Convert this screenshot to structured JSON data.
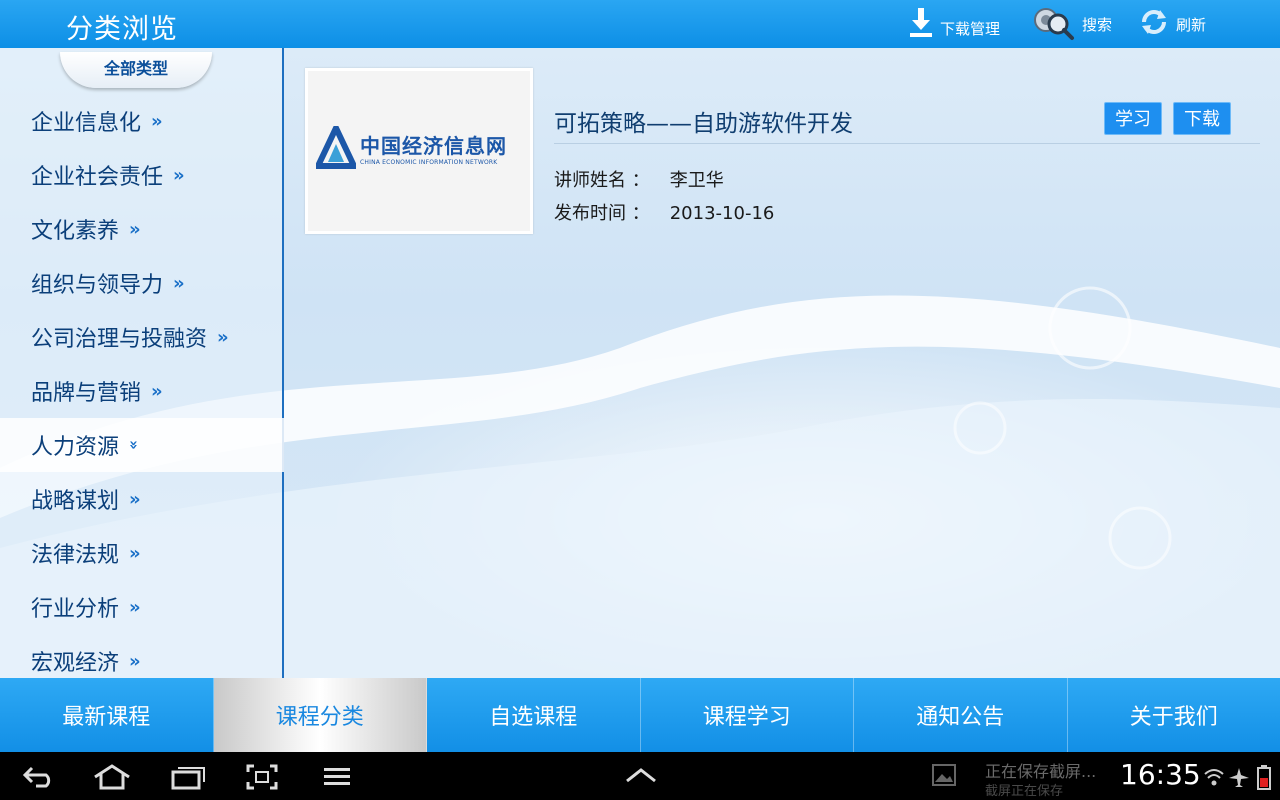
{
  "topbar": {
    "title": "分类浏览",
    "download_label": "下载管理",
    "search_label": "搜索",
    "refresh_label": "刷新"
  },
  "sidebar": {
    "header": "全部类型",
    "items": [
      {
        "label": "企业信息化",
        "active": false
      },
      {
        "label": "企业社会责任",
        "active": false
      },
      {
        "label": "文化素养",
        "active": false
      },
      {
        "label": "组织与领导力",
        "active": false
      },
      {
        "label": "公司治理与投融资",
        "active": false
      },
      {
        "label": "品牌与营销",
        "active": false
      },
      {
        "label": "人力资源",
        "active": true
      },
      {
        "label": "战略谋划",
        "active": false
      },
      {
        "label": "法律法规",
        "active": false
      },
      {
        "label": "行业分析",
        "active": false
      },
      {
        "label": "宏观经济",
        "active": false
      }
    ]
  },
  "course": {
    "logo_cn": "中国经济信息网",
    "logo_en": "CHINA ECONOMIC INFORMATION NETWORK",
    "title": "可拓策略——自助游软件开发",
    "study_label": "学习",
    "download_label": "下载",
    "teacher_label": "讲师姓名 ：",
    "teacher": "李卫华",
    "date_label": "发布时间 ：",
    "date": "2013-10-16"
  },
  "tabs": [
    {
      "label": "最新课程",
      "active": false
    },
    {
      "label": "课程分类",
      "active": true
    },
    {
      "label": "自选课程",
      "active": false
    },
    {
      "label": "课程学习",
      "active": false
    },
    {
      "label": "通知公告",
      "active": false
    },
    {
      "label": "关于我们",
      "active": false
    }
  ],
  "system": {
    "notification_line1": "正在保存截屏...",
    "notification_line2": "截屏正在保存",
    "time": "16:35"
  },
  "colors": {
    "accent": "#1e8ff0",
    "text_dark": "#0b3f7a"
  }
}
